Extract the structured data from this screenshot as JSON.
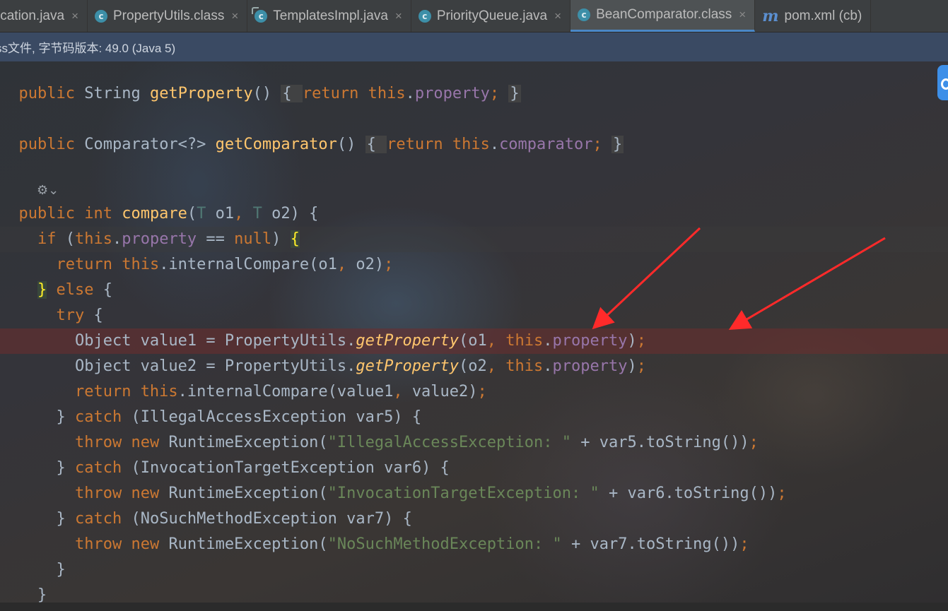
{
  "tabs": [
    {
      "name": "ication.java",
      "icon": "none",
      "active": false
    },
    {
      "name": "PropertyUtils.class",
      "icon": "class-icon",
      "active": false
    },
    {
      "name": "TemplatesImpl.java",
      "icon": "modified-class-icon",
      "active": false
    },
    {
      "name": "PriorityQueue.java",
      "icon": "class-icon",
      "active": false
    },
    {
      "name": "BeanComparator.class",
      "icon": "class-icon",
      "active": true
    },
    {
      "name": "pom.xml (cb)",
      "icon": "maven-icon",
      "active": false
    }
  ],
  "tab_close_glyph": "×",
  "class_icon_letter": "c",
  "maven_icon_letter": "m",
  "info_bar": {
    "text": "ss文件, 字节码版本: 49.0 (Java 5)"
  },
  "colors": {
    "keyword": "#cc7832",
    "method": "#ffc66d",
    "field": "#9876aa",
    "string": "#6a8759",
    "text": "#a9b7c6",
    "breakpoint_line": "#6e2d2d",
    "annotation_arrow": "#ff2a2a",
    "accent": "#4a88c7"
  },
  "code": {
    "l1": {
      "kw1": "public",
      "t1": " String ",
      "fn": "getProperty",
      "t2": "() ",
      "fold_open": "{ ",
      "kw2": "return ",
      "kw3": "this",
      "t3": ".",
      "fld": "property",
      "semi": "; ",
      "fold_close": "}"
    },
    "l2": {
      "kw1": "public",
      "t1": " Comparator<?> ",
      "fn": "getComparator",
      "t2": "() ",
      "fold_open": "{ ",
      "kw2": "return ",
      "kw3": "this",
      "t3": ".",
      "fld": "comparator",
      "semi": "; ",
      "fold_close": "}"
    },
    "l3": {
      "kw1": "public ",
      "kw2": "int ",
      "fn": "compare",
      "t1": "(",
      "tp1": "T",
      "t2": " o1",
      "c1": ", ",
      "tp2": "T",
      "t3": " o2) {"
    },
    "l4": {
      "kw1": "if",
      "t1": " (",
      "kw2": "this",
      "t2": ".",
      "fld": "property",
      "t3": " == ",
      "kw3": "null",
      "t4": ") ",
      "brace": "{"
    },
    "l5": {
      "kw1": "return ",
      "kw2": "this",
      "t1": ".internalCompare(o1",
      "c1": ", ",
      "t2": "o2)",
      "semi": ";"
    },
    "l6": {
      "brace": "}",
      "t1": " ",
      "kw1": "else",
      "t2": " {"
    },
    "l7": {
      "kw1": "try",
      "t1": " {"
    },
    "l8": {
      "t1": "Object value1 = PropertyUtils.",
      "fn": "getProperty",
      "t2": "(o1",
      "c1": ", ",
      "kw1": "this",
      "t3": ".",
      "fld": "property",
      "t4": ")",
      "semi": ";"
    },
    "l9": {
      "t1": "Object value2 = PropertyUtils.",
      "fn": "getProperty",
      "t2": "(o2",
      "c1": ", ",
      "kw1": "this",
      "t3": ".",
      "fld": "property",
      "t4": ")",
      "semi": ";"
    },
    "l10": {
      "kw1": "return ",
      "kw2": "this",
      "t1": ".internalCompare(value1",
      "c1": ", ",
      "t2": "value2)",
      "semi": ";"
    },
    "l11": {
      "t1": "} ",
      "kw1": "catch",
      "t2": " (IllegalAccessException var5) {"
    },
    "l12": {
      "kw1": "throw ",
      "kw2": "new ",
      "t1": "RuntimeException(",
      "str": "\"IllegalAccessException: \"",
      "t2": " + var5.toString())",
      "semi": ";"
    },
    "l13": {
      "t1": "} ",
      "kw1": "catch",
      "t2": " (InvocationTargetException var6) {"
    },
    "l14": {
      "kw1": "throw ",
      "kw2": "new ",
      "t1": "RuntimeException(",
      "str": "\"InvocationTargetException: \"",
      "t2": " + var6.toString())",
      "semi": ";"
    },
    "l15": {
      "t1": "} ",
      "kw1": "catch",
      "t2": " (NoSuchMethodException var7) {"
    },
    "l16": {
      "kw1": "throw ",
      "kw2": "new ",
      "t1": "RuntimeException(",
      "str": "\"NoSuchMethodException: \"",
      "t2": " + var7.toString())",
      "semi": ";"
    },
    "l17": {
      "t1": "}"
    },
    "l18": {
      "t1": "}"
    }
  },
  "gutter": {
    "icon": "implementation-gutter-icon",
    "glyph": "⚙",
    "chevron": "⌄"
  }
}
